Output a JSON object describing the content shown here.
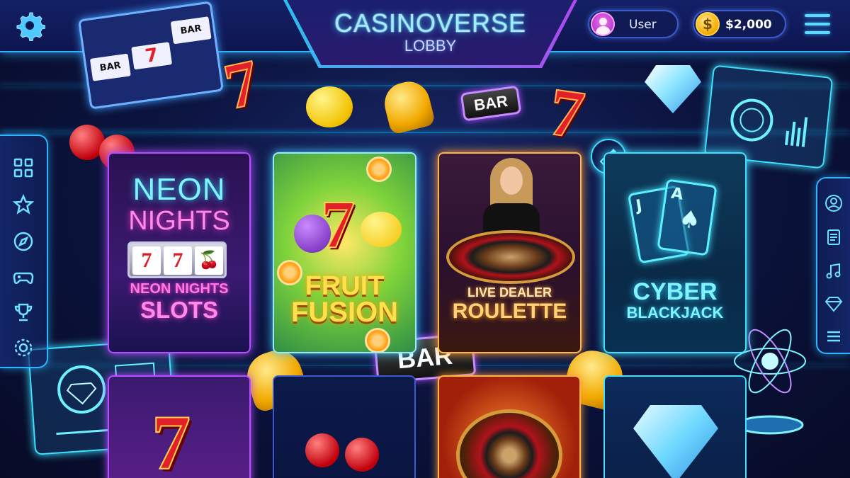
{
  "header": {
    "title": "CASINOVERSE",
    "subtitle": "LOBBY",
    "user_label": "User",
    "balance": "$2,000",
    "coin_symbol": "$"
  },
  "left_rail": {
    "icons": [
      "grid-icon",
      "star-icon",
      "compass-icon",
      "gamepad-icon",
      "trophy-icon",
      "settings-icon"
    ]
  },
  "right_rail": {
    "icons": [
      "profile-icon",
      "document-icon",
      "music-icon",
      "diamond-icon",
      "list-icon"
    ]
  },
  "games": [
    {
      "id": "neon-nights",
      "logo_line1": "NEON",
      "logo_line2": "NIGHTS",
      "title_line1": "NEON NIGHTS",
      "title_line2": "SLOTS",
      "reels": [
        "7",
        "7",
        "🍒"
      ],
      "accent": "#b64dff"
    },
    {
      "id": "fruit-fusion",
      "logo_symbol": "7",
      "title_line1": "FRUIT",
      "title_line2": "FUSION",
      "accent": "#3fd0ff"
    },
    {
      "id": "live-dealer-roulette",
      "title_line1": "LIVE DEALER",
      "title_line2": "ROULETTE",
      "accent": "#ff9d2e"
    },
    {
      "id": "cyber-blackjack",
      "title_line1": "CYBER",
      "title_line2": "BLACKJACK",
      "card1": "J",
      "card2": "A",
      "accent": "#3fe0ff"
    }
  ],
  "bottom_games": [
    {
      "id": "sevens-slots",
      "symbol": "7"
    },
    {
      "id": "cherry-game"
    },
    {
      "id": "roulette-game"
    },
    {
      "id": "diamond-game"
    }
  ],
  "decor": {
    "bar_label": "BAR",
    "seven": "7",
    "slot_cells": [
      "BAR",
      "7",
      "BAR"
    ]
  },
  "colors": {
    "neon_cyan": "#2fb6ff",
    "neon_purple": "#b64dff",
    "gold": "#f2a900"
  }
}
